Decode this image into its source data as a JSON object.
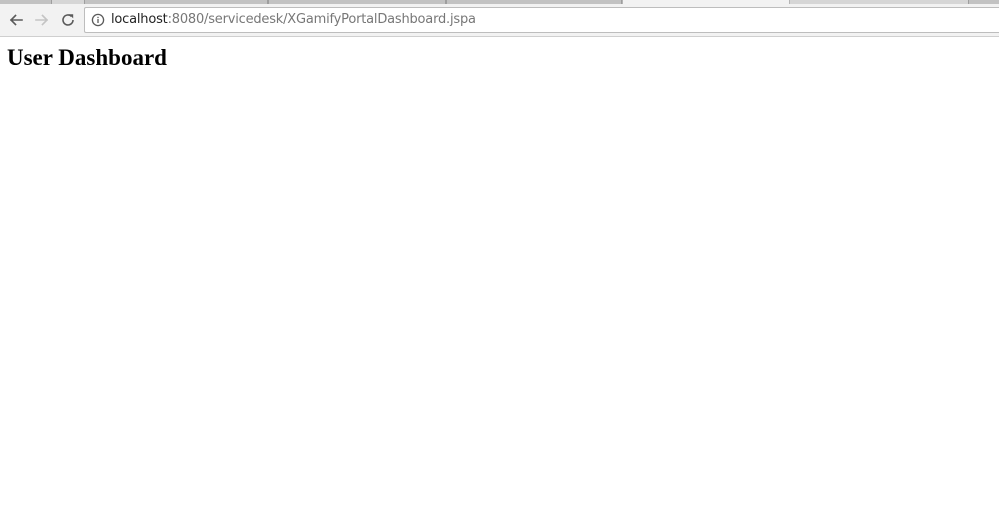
{
  "browser": {
    "address_bar": {
      "host": "localhost",
      "path": ":8080/servicedesk/XGamifyPortalDashboard.jspa"
    },
    "icons": {
      "back": "back-arrow-icon",
      "forward": "forward-arrow-icon",
      "reload": "reload-icon",
      "site_info": "info-circle-icon"
    }
  },
  "page": {
    "title": "User Dashboard"
  }
}
